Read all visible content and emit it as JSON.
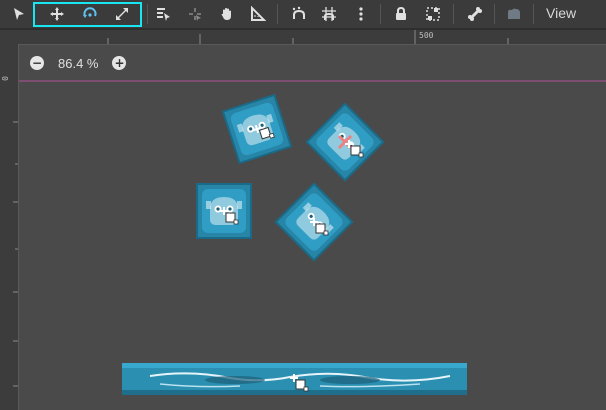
{
  "toolbar": {
    "tools": [
      {
        "name": "select-tool",
        "icon": "arrow-cursor-icon"
      },
      {
        "name": "move-tool",
        "icon": "move-cross-icon"
      },
      {
        "name": "rotate-tool",
        "icon": "rotate-icon"
      },
      {
        "name": "scale-tool",
        "icon": "scale-icon"
      },
      {
        "name": "list-select-tool",
        "icon": "list-select-icon"
      },
      {
        "name": "pivot-tool",
        "icon": "pivot-icon"
      },
      {
        "name": "pan-tool",
        "icon": "hand-icon"
      },
      {
        "name": "ruler-tool",
        "icon": "ruler-icon"
      },
      {
        "name": "smart-snap-tool",
        "icon": "smart-snap-icon"
      },
      {
        "name": "grid-snap-tool",
        "icon": "grid-snap-icon"
      },
      {
        "name": "snap-options",
        "icon": "kebab-icon"
      },
      {
        "name": "lock-tool",
        "icon": "lock-icon"
      },
      {
        "name": "group-tool",
        "icon": "group-icon"
      },
      {
        "name": "bone-tool",
        "icon": "bone-icon"
      },
      {
        "name": "camera-tool",
        "icon": "camera-icon"
      }
    ],
    "view_label": "View",
    "highlight_color": "#18e6f2"
  },
  "ruler": {
    "top_mark": "500",
    "left_mark": "0"
  },
  "zoom": {
    "minus": "−",
    "value": "86.4 %",
    "plus": "+"
  },
  "colors": {
    "guide_line": "#b0509a",
    "sprite_teal": "#2a8fb0",
    "sprite_dark": "#1f6f8c",
    "icon_light": "#dfe6ec",
    "icon_blue": "#3fb3e8"
  }
}
